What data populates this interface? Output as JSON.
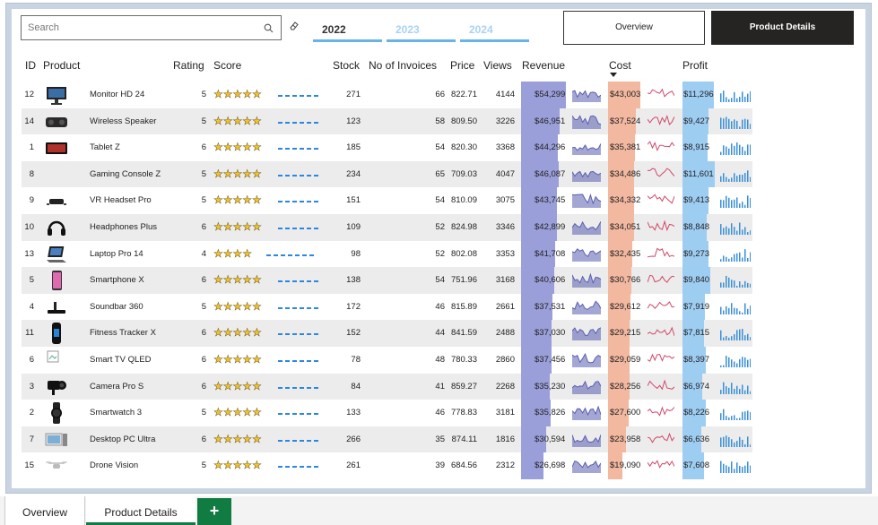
{
  "search": {
    "placeholder": "Search"
  },
  "years": [
    "2022",
    "2023",
    "2024"
  ],
  "active_year": "2022",
  "colors": {
    "revenue_bar": "#9b9fd9",
    "cost_bar": "#f2b8a0",
    "profit_bar": "#9ecdf2",
    "revenue_line": "#5a5fb0",
    "cost_line": "#d0496a",
    "profit_line": "#3a8fd8",
    "star": "#f0c22e",
    "tab_accent": "#107c41"
  },
  "buttons": {
    "overview": "Overview",
    "product_details": "Product Details"
  },
  "columns": [
    "ID",
    "Product",
    "Rating",
    "Score",
    "Stock",
    "No of Invoices",
    "Price",
    "Views",
    "Revenue",
    "Cost",
    "Profit"
  ],
  "sort": {
    "column": "Cost",
    "direction": "descending"
  },
  "rows": [
    {
      "id": "12",
      "product": "Monitor HD 24",
      "rating": "5",
      "stars": 5,
      "stock": "271",
      "invoices": "66",
      "price": "822.71",
      "views": "4144",
      "revenue": "$54,299",
      "cost": "$43,003",
      "profit": "$11,296",
      "rev_n": 54299,
      "cost_n": 43003,
      "profit_n": 11296,
      "img": "monitor-image"
    },
    {
      "id": "14",
      "product": "Wireless Speaker",
      "rating": "5",
      "stars": 5,
      "stock": "123",
      "invoices": "58",
      "price": "809.50",
      "views": "3226",
      "revenue": "$46,951",
      "cost": "$37,524",
      "profit": "$9,427",
      "rev_n": 46951,
      "cost_n": 37524,
      "profit_n": 9427,
      "img": "speaker-image"
    },
    {
      "id": "1",
      "product": "Tablet Z",
      "rating": "6",
      "stars": 5,
      "stock": "185",
      "invoices": "54",
      "price": "820.30",
      "views": "3368",
      "revenue": "$44,296",
      "cost": "$35,381",
      "profit": "$8,915",
      "rev_n": 44296,
      "cost_n": 35381,
      "profit_n": 8915,
      "img": "tablet-image"
    },
    {
      "id": "8",
      "product": "Gaming Console Z",
      "rating": "5",
      "stars": 5,
      "stock": "234",
      "invoices": "65",
      "price": "709.03",
      "views": "4047",
      "revenue": "$46,087",
      "cost": "$34,486",
      "profit": "$11,601",
      "rev_n": 46087,
      "cost_n": 34486,
      "profit_n": 11601,
      "img": ""
    },
    {
      "id": "9",
      "product": "VR Headset Pro",
      "rating": "5",
      "stars": 5,
      "stock": "151",
      "invoices": "54",
      "price": "810.09",
      "views": "3075",
      "revenue": "$43,745",
      "cost": "$34,332",
      "profit": "$9,413",
      "rev_n": 43745,
      "cost_n": 34332,
      "profit_n": 9413,
      "img": "vr-headset-image"
    },
    {
      "id": "10",
      "product": "Headphones Plus",
      "rating": "6",
      "stars": 5,
      "stock": "109",
      "invoices": "52",
      "price": "824.98",
      "views": "3346",
      "revenue": "$42,899",
      "cost": "$34,051",
      "profit": "$8,848",
      "rev_n": 42899,
      "cost_n": 34051,
      "profit_n": 8848,
      "img": "headphones-image"
    },
    {
      "id": "13",
      "product": "Laptop Pro 14",
      "rating": "4",
      "stars": 4,
      "stock": "98",
      "invoices": "52",
      "price": "802.08",
      "views": "3353",
      "revenue": "$41,708",
      "cost": "$32,435",
      "profit": "$9,273",
      "rev_n": 41708,
      "cost_n": 32435,
      "profit_n": 9273,
      "img": "laptop-image"
    },
    {
      "id": "5",
      "product": "Smartphone X",
      "rating": "6",
      "stars": 5,
      "stock": "138",
      "invoices": "54",
      "price": "751.96",
      "views": "3168",
      "revenue": "$40,606",
      "cost": "$30,766",
      "profit": "$9,840",
      "rev_n": 40606,
      "cost_n": 30766,
      "profit_n": 9840,
      "img": "smartphone-image"
    },
    {
      "id": "4",
      "product": "Soundbar 360",
      "rating": "5",
      "stars": 5,
      "stock": "172",
      "invoices": "46",
      "price": "815.89",
      "views": "2661",
      "revenue": "$37,531",
      "cost": "$29,612",
      "profit": "$7,919",
      "rev_n": 37531,
      "cost_n": 29612,
      "profit_n": 7919,
      "img": "soundbar-image"
    },
    {
      "id": "11",
      "product": "Fitness Tracker X",
      "rating": "6",
      "stars": 5,
      "stock": "152",
      "invoices": "44",
      "price": "841.59",
      "views": "2488",
      "revenue": "$37,030",
      "cost": "$29,215",
      "profit": "$7,815",
      "rev_n": 37030,
      "cost_n": 29215,
      "profit_n": 7815,
      "img": "fitness-tracker-image"
    },
    {
      "id": "6",
      "product": "Smart TV QLED",
      "rating": "6",
      "stars": 5,
      "stock": "78",
      "invoices": "48",
      "price": "780.33",
      "views": "2860",
      "revenue": "$37,456",
      "cost": "$29,059",
      "profit": "$8,397",
      "rev_n": 37456,
      "cost_n": 29059,
      "profit_n": 8397,
      "img": "broken-image"
    },
    {
      "id": "3",
      "product": "Camera Pro S",
      "rating": "6",
      "stars": 5,
      "stock": "84",
      "invoices": "41",
      "price": "859.27",
      "views": "2268",
      "revenue": "$35,230",
      "cost": "$28,256",
      "profit": "$6,974",
      "rev_n": 35230,
      "cost_n": 28256,
      "profit_n": 6974,
      "img": "camera-image"
    },
    {
      "id": "2",
      "product": "Smartwatch 3",
      "rating": "5",
      "stars": 5,
      "stock": "133",
      "invoices": "46",
      "price": "778.83",
      "views": "3181",
      "revenue": "$35,826",
      "cost": "$27,600",
      "profit": "$8,226",
      "rev_n": 35826,
      "cost_n": 27600,
      "profit_n": 8226,
      "img": "smartwatch-image"
    },
    {
      "id": "7",
      "product": "Desktop PC Ultra",
      "rating": "6",
      "stars": 5,
      "stock": "266",
      "invoices": "35",
      "price": "874.11",
      "views": "1816",
      "revenue": "$30,594",
      "cost": "$23,958",
      "profit": "$6,636",
      "rev_n": 30594,
      "cost_n": 23958,
      "profit_n": 6636,
      "img": "desktop-pc-image"
    },
    {
      "id": "15",
      "product": "Drone Vision",
      "rating": "5",
      "stars": 5,
      "stock": "261",
      "invoices": "39",
      "price": "684.56",
      "views": "2312",
      "revenue": "$26,698",
      "cost": "$19,090",
      "profit": "$7,608",
      "rev_n": 26698,
      "cost_n": 19090,
      "profit_n": 7608,
      "img": "drone-image"
    }
  ],
  "sheet_tabs": [
    "Overview",
    "Product Details"
  ],
  "add_tab": "+"
}
